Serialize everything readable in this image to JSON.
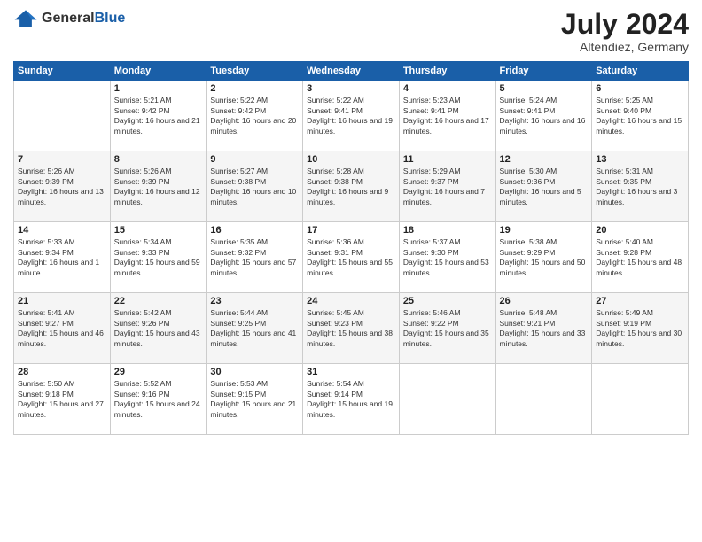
{
  "header": {
    "logo_general": "General",
    "logo_blue": "Blue",
    "month_year": "July 2024",
    "location": "Altendiez, Germany"
  },
  "days_of_week": [
    "Sunday",
    "Monday",
    "Tuesday",
    "Wednesday",
    "Thursday",
    "Friday",
    "Saturday"
  ],
  "weeks": [
    [
      {
        "day": "",
        "empty": true
      },
      {
        "day": "1",
        "sunrise": "Sunrise: 5:21 AM",
        "sunset": "Sunset: 9:42 PM",
        "daylight": "Daylight: 16 hours and 21 minutes."
      },
      {
        "day": "2",
        "sunrise": "Sunrise: 5:22 AM",
        "sunset": "Sunset: 9:42 PM",
        "daylight": "Daylight: 16 hours and 20 minutes."
      },
      {
        "day": "3",
        "sunrise": "Sunrise: 5:22 AM",
        "sunset": "Sunset: 9:41 PM",
        "daylight": "Daylight: 16 hours and 19 minutes."
      },
      {
        "day": "4",
        "sunrise": "Sunrise: 5:23 AM",
        "sunset": "Sunset: 9:41 PM",
        "daylight": "Daylight: 16 hours and 17 minutes."
      },
      {
        "day": "5",
        "sunrise": "Sunrise: 5:24 AM",
        "sunset": "Sunset: 9:41 PM",
        "daylight": "Daylight: 16 hours and 16 minutes."
      },
      {
        "day": "6",
        "sunrise": "Sunrise: 5:25 AM",
        "sunset": "Sunset: 9:40 PM",
        "daylight": "Daylight: 16 hours and 15 minutes."
      }
    ],
    [
      {
        "day": "7",
        "sunrise": "Sunrise: 5:26 AM",
        "sunset": "Sunset: 9:39 PM",
        "daylight": "Daylight: 16 hours and 13 minutes."
      },
      {
        "day": "8",
        "sunrise": "Sunrise: 5:26 AM",
        "sunset": "Sunset: 9:39 PM",
        "daylight": "Daylight: 16 hours and 12 minutes."
      },
      {
        "day": "9",
        "sunrise": "Sunrise: 5:27 AM",
        "sunset": "Sunset: 9:38 PM",
        "daylight": "Daylight: 16 hours and 10 minutes."
      },
      {
        "day": "10",
        "sunrise": "Sunrise: 5:28 AM",
        "sunset": "Sunset: 9:38 PM",
        "daylight": "Daylight: 16 hours and 9 minutes."
      },
      {
        "day": "11",
        "sunrise": "Sunrise: 5:29 AM",
        "sunset": "Sunset: 9:37 PM",
        "daylight": "Daylight: 16 hours and 7 minutes."
      },
      {
        "day": "12",
        "sunrise": "Sunrise: 5:30 AM",
        "sunset": "Sunset: 9:36 PM",
        "daylight": "Daylight: 16 hours and 5 minutes."
      },
      {
        "day": "13",
        "sunrise": "Sunrise: 5:31 AM",
        "sunset": "Sunset: 9:35 PM",
        "daylight": "Daylight: 16 hours and 3 minutes."
      }
    ],
    [
      {
        "day": "14",
        "sunrise": "Sunrise: 5:33 AM",
        "sunset": "Sunset: 9:34 PM",
        "daylight": "Daylight: 16 hours and 1 minute."
      },
      {
        "day": "15",
        "sunrise": "Sunrise: 5:34 AM",
        "sunset": "Sunset: 9:33 PM",
        "daylight": "Daylight: 15 hours and 59 minutes."
      },
      {
        "day": "16",
        "sunrise": "Sunrise: 5:35 AM",
        "sunset": "Sunset: 9:32 PM",
        "daylight": "Daylight: 15 hours and 57 minutes."
      },
      {
        "day": "17",
        "sunrise": "Sunrise: 5:36 AM",
        "sunset": "Sunset: 9:31 PM",
        "daylight": "Daylight: 15 hours and 55 minutes."
      },
      {
        "day": "18",
        "sunrise": "Sunrise: 5:37 AM",
        "sunset": "Sunset: 9:30 PM",
        "daylight": "Daylight: 15 hours and 53 minutes."
      },
      {
        "day": "19",
        "sunrise": "Sunrise: 5:38 AM",
        "sunset": "Sunset: 9:29 PM",
        "daylight": "Daylight: 15 hours and 50 minutes."
      },
      {
        "day": "20",
        "sunrise": "Sunrise: 5:40 AM",
        "sunset": "Sunset: 9:28 PM",
        "daylight": "Daylight: 15 hours and 48 minutes."
      }
    ],
    [
      {
        "day": "21",
        "sunrise": "Sunrise: 5:41 AM",
        "sunset": "Sunset: 9:27 PM",
        "daylight": "Daylight: 15 hours and 46 minutes."
      },
      {
        "day": "22",
        "sunrise": "Sunrise: 5:42 AM",
        "sunset": "Sunset: 9:26 PM",
        "daylight": "Daylight: 15 hours and 43 minutes."
      },
      {
        "day": "23",
        "sunrise": "Sunrise: 5:44 AM",
        "sunset": "Sunset: 9:25 PM",
        "daylight": "Daylight: 15 hours and 41 minutes."
      },
      {
        "day": "24",
        "sunrise": "Sunrise: 5:45 AM",
        "sunset": "Sunset: 9:23 PM",
        "daylight": "Daylight: 15 hours and 38 minutes."
      },
      {
        "day": "25",
        "sunrise": "Sunrise: 5:46 AM",
        "sunset": "Sunset: 9:22 PM",
        "daylight": "Daylight: 15 hours and 35 minutes."
      },
      {
        "day": "26",
        "sunrise": "Sunrise: 5:48 AM",
        "sunset": "Sunset: 9:21 PM",
        "daylight": "Daylight: 15 hours and 33 minutes."
      },
      {
        "day": "27",
        "sunrise": "Sunrise: 5:49 AM",
        "sunset": "Sunset: 9:19 PM",
        "daylight": "Daylight: 15 hours and 30 minutes."
      }
    ],
    [
      {
        "day": "28",
        "sunrise": "Sunrise: 5:50 AM",
        "sunset": "Sunset: 9:18 PM",
        "daylight": "Daylight: 15 hours and 27 minutes."
      },
      {
        "day": "29",
        "sunrise": "Sunrise: 5:52 AM",
        "sunset": "Sunset: 9:16 PM",
        "daylight": "Daylight: 15 hours and 24 minutes."
      },
      {
        "day": "30",
        "sunrise": "Sunrise: 5:53 AM",
        "sunset": "Sunset: 9:15 PM",
        "daylight": "Daylight: 15 hours and 21 minutes."
      },
      {
        "day": "31",
        "sunrise": "Sunrise: 5:54 AM",
        "sunset": "Sunset: 9:14 PM",
        "daylight": "Daylight: 15 hours and 19 minutes."
      },
      {
        "day": "",
        "empty": true
      },
      {
        "day": "",
        "empty": true
      },
      {
        "day": "",
        "empty": true
      }
    ]
  ]
}
